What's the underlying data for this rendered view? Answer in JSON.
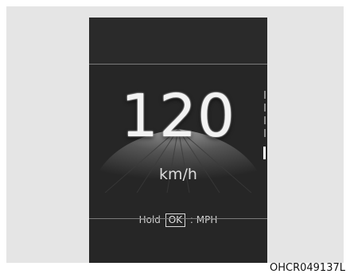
{
  "display": {
    "speed_value": "120",
    "speed_unit": "km/h",
    "hint_prefix": "Hold",
    "hint_key": "OK",
    "hint_suffix": ": MPH"
  },
  "caption": "OHCR049137L"
}
